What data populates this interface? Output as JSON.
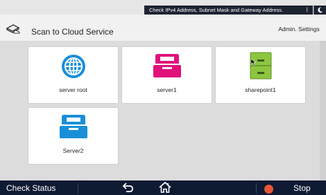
{
  "status_bar": {
    "message": "Check IPv4 Address, Subnet Mask and Gateway Address.",
    "corner_glyph": "⌋",
    "moon_icon": "moon-icon"
  },
  "header": {
    "title": "Scan to Cloud Service",
    "admin_settings_label": "Admin. Settings",
    "app_icon": "scanner-cloud-icon"
  },
  "destinations": [
    {
      "label": "server root",
      "icon": "globe-icon",
      "color": "#1a8fd8"
    },
    {
      "label": "server1",
      "icon": "tray-icon",
      "color": "#e0127a"
    },
    {
      "label": "sharepoint1",
      "icon": "cabinet-icon",
      "color": "#8cc63e"
    },
    {
      "label": "Server2",
      "icon": "tray-icon",
      "color": "#1a8fd8"
    }
  ],
  "bottom_bar": {
    "check_status_label": "Check Status",
    "back_icon": "back-arrow-icon",
    "home_icon": "home-icon",
    "stop_label": "Stop",
    "stop_color": "#e8553a"
  }
}
